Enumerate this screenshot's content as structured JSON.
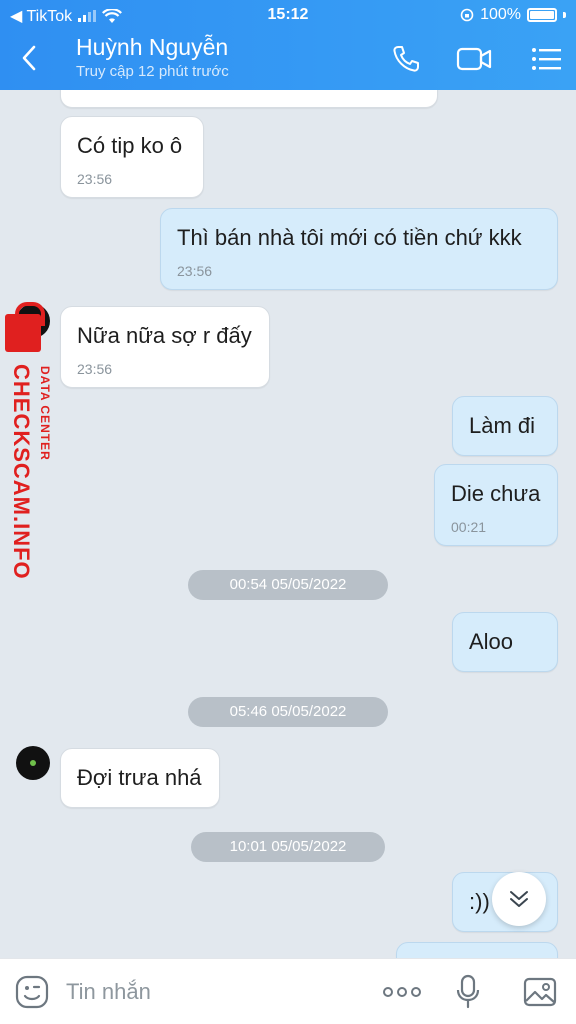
{
  "status_bar": {
    "carrier": "◀ TikTok",
    "time": "15:12",
    "battery": "100%"
  },
  "header": {
    "contact_name": "Huỳnh Nguyễn",
    "contact_status": "Truy cập 12 phút trước"
  },
  "watermark": {
    "main": "CHECKSCAM.INFO",
    "sub": "DATA CENTER"
  },
  "messages": [
    {
      "text": "Có tip ko ô",
      "time": "23:56"
    },
    {
      "text": "Thì bán nhà tôi mới có tiền chứ kkk",
      "time": "23:56"
    },
    {
      "text": "Nữa nữa sợ r đấy",
      "time": "23:56"
    },
    {
      "text": "Làm đi"
    },
    {
      "text": "Die chưa",
      "time": "00:21"
    },
    {
      "text": "Aloo"
    },
    {
      "text": "Đợi trưa nhá"
    },
    {
      "text": ":))"
    }
  ],
  "date_separators": [
    "00:54 05/05/2022",
    "05:46 05/05/2022",
    "10:01 05/05/2022"
  ],
  "input": {
    "placeholder": "Tin nhắn"
  },
  "colors": {
    "header": "#2f8ff2",
    "outgoing": "#d6ecfb",
    "incoming": "#ffffff",
    "chat_bg": "#e2e8ee"
  }
}
